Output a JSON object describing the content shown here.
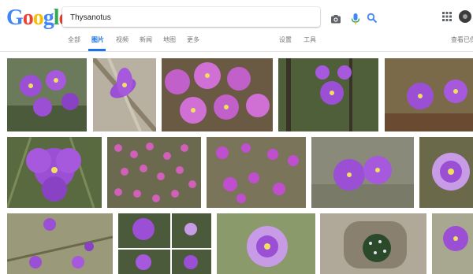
{
  "logo": {
    "letters": [
      "G",
      "o",
      "o",
      "g",
      "l",
      "e"
    ]
  },
  "search": {
    "value": "Thysanotus"
  },
  "icons": {
    "camera": "camera-icon",
    "mic": "mic-icon",
    "search": "search-icon",
    "apps": "apps-grid-icon",
    "account": "account-icon"
  },
  "tabs": [
    {
      "label": "全部",
      "active": false
    },
    {
      "label": "图片",
      "active": true
    },
    {
      "label": "视频",
      "active": false
    },
    {
      "label": "新闻",
      "active": false
    },
    {
      "label": "地图",
      "active": false
    },
    {
      "label": "更多",
      "active": false
    }
  ],
  "tools": {
    "settings": "设置",
    "tools": "工具",
    "safesearch": "查看已保存"
  },
  "colors": {
    "accent": "#1a73e8",
    "flower": "#9b4fd4",
    "flower_light": "#c79be6"
  },
  "results": {
    "count": 17,
    "subject": "purple fringe lily flowers"
  }
}
